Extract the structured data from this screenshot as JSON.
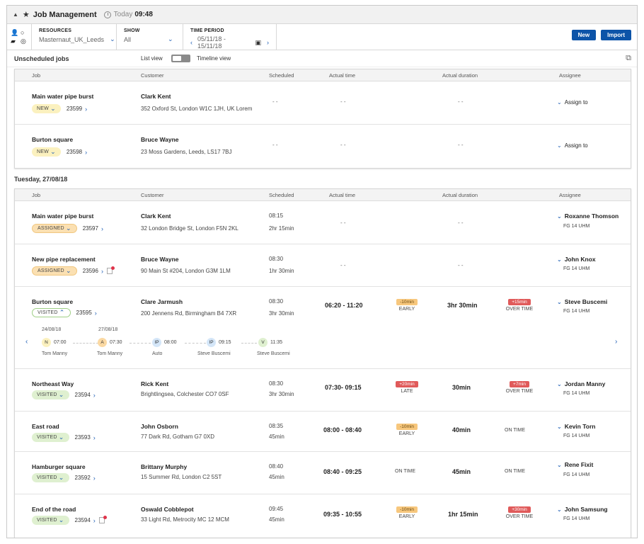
{
  "window": {
    "title": "Job Management",
    "today_label": "Today",
    "time": "09:48"
  },
  "toolbar": {
    "resources_label": "RESOURCES",
    "resources_value": "Masternaut_UK_Leeds",
    "show_label": "SHOW",
    "show_value": "All",
    "period_label": "TIME PERIOD",
    "period_value": "05/11/18 - 15/11/18",
    "new_label": "New",
    "import_label": "Import"
  },
  "unscheduled": {
    "title": "Unscheduled jobs",
    "list_view": "List view",
    "timeline_view": "Timeline view"
  },
  "columns": {
    "job": "Job",
    "customer": "Customer",
    "scheduled": "Scheduled",
    "actual_time": "Actual time",
    "actual_duration": "Actual duration",
    "assignee": "Assignee"
  },
  "unscheduled_jobs": [
    {
      "title": "Main water pipe burst",
      "status": "NEW",
      "number": "23599",
      "customer": "Clark Kent",
      "address": "352 Oxford St, London W1C 1JH, UK Lorem",
      "scheduled": "- -",
      "actual": "- -",
      "duration": "- -",
      "assignee": "Assign to"
    },
    {
      "title": "Burton square",
      "status": "NEW",
      "number": "23598",
      "customer": "Bruce Wayne",
      "address": "23 Moss Gardens, Leeds, LS17 7BJ",
      "scheduled": "- -",
      "actual": "- -",
      "duration": "- -",
      "assignee": "Assign to"
    }
  ],
  "day_section": {
    "title": "Tuesday, 27/08/18"
  },
  "jobs": [
    {
      "title": "Main water pipe burst",
      "status": "ASSIGNED",
      "number": "23597",
      "customer": "Clark Kent",
      "address": "32 London Bridge St, London F5N 2KL",
      "sched_time": "08:15",
      "sched_dur": "2hr 15min",
      "actual": "- -",
      "duration": "- -",
      "assignee": "Roxanne Thomson",
      "fg": "FG 14 UHM"
    },
    {
      "title": "New pipe replacement",
      "status": "ASSIGNED",
      "number": "23596",
      "customer": "Bruce Wayne",
      "address": "90 Main St #204, London G3M 1LM",
      "sched_time": "08:30",
      "sched_dur": "1hr 30min",
      "actual": "- -",
      "duration": "- -",
      "assignee": "John Knox",
      "fg": "FG 14 UHM"
    },
    {
      "title": "Burton square",
      "status": "VISITED",
      "number": "23595",
      "customer": "Clare Jarmush",
      "address": "200 Jennens Rd, Birmingham B4 7XR",
      "sched_time": "08:30",
      "sched_dur": "3hr 30min",
      "actual": "06:20 - 11:20",
      "time_pill": "-10min",
      "time_label": "EARLY",
      "duration": "3hr 30min",
      "dur_pill": "+15min",
      "dur_label": "OVER TIME",
      "assignee": "Steve Buscemi",
      "fg": "FG 14 UHM",
      "timeline": {
        "date1": "24/08/18",
        "date2": "27/08/18",
        "nodes": [
          {
            "code": "N",
            "time": "07:00",
            "who": "Tom Manny"
          },
          {
            "code": "A",
            "time": "07:30",
            "who": "Tom Manny"
          },
          {
            "code": "IP",
            "time": "08:00",
            "who": "Auto"
          },
          {
            "code": "IP",
            "time": "09:15",
            "who": "Steve Buscemi"
          },
          {
            "code": "V",
            "time": "11:35",
            "who": "Steve Buscemi"
          }
        ]
      }
    },
    {
      "title": "Northeast Way",
      "status": "VISITED",
      "number": "23594",
      "customer": "Rick Kent",
      "address": "Brightlingsea, Colchester CO7 0SF",
      "sched_time": "08:30",
      "sched_dur": "3hr 30min",
      "actual": "07:30- 09:15",
      "time_pill": "+20min",
      "time_label": "LATE",
      "duration": "30min",
      "dur_pill": "+7min",
      "dur_label": "OVER TIME",
      "assignee": "Jordan Manny",
      "fg": "FG 14 UHM"
    },
    {
      "title": "East road",
      "status": "VISITED",
      "number": "23593",
      "customer": "John Osborn",
      "address": "77 Dark Rd, Gotham G7 0XD",
      "sched_time": "08:35",
      "sched_dur": "45min",
      "actual": "08:00 - 08:40",
      "time_pill": "-10min",
      "time_label": "EARLY",
      "duration": "40min",
      "dur_label": "ON TIME",
      "assignee": "Kevin Torn",
      "fg": "FG 14 UHM"
    },
    {
      "title": "Hamburger square",
      "status": "VISITED",
      "number": "23592",
      "customer": "Brittany Murphy",
      "address": "15 Summer Rd, London C2 5ST",
      "sched_time": "08:40",
      "sched_dur": "45min",
      "actual": "08:40 - 09:25",
      "time_label": "ON TIME",
      "duration": "45min",
      "dur_label": "ON TIME",
      "assignee": "Rene Fixit",
      "fg": "FG 14 UHM"
    },
    {
      "title": "End of the road",
      "status": "VISITED",
      "number": "23594",
      "customer": "Oswald Cobblepot",
      "address": "33 Light Rd, Metrocity MC 12 MCM",
      "sched_time": "09:45",
      "sched_dur": "45min",
      "actual": "09:35 - 10:55",
      "time_pill": "-10min",
      "time_label": "EARLY",
      "duration": "1hr 15min",
      "dur_pill": "+30min",
      "dur_label": "OVER TIME",
      "assignee": "John Samsung",
      "fg": "FG 14 UHM"
    }
  ]
}
